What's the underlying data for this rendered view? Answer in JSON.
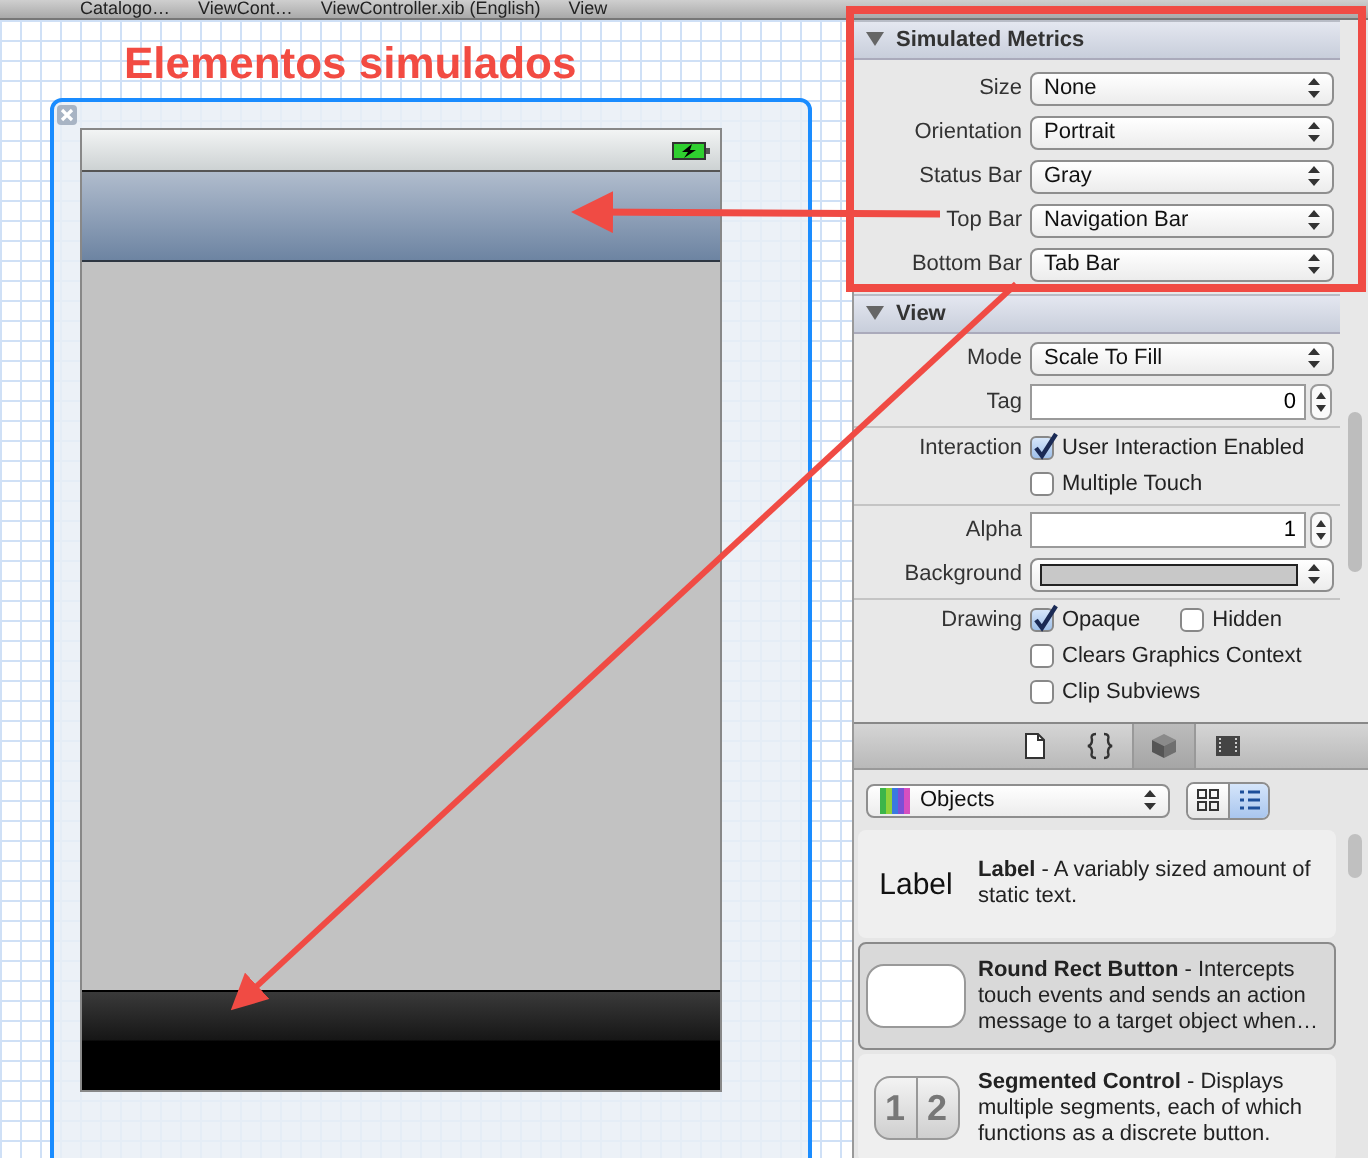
{
  "breadcrumbs": [
    {
      "label": "Catalogo…"
    },
    {
      "label": "ViewCont…"
    },
    {
      "label": "ViewController.xib (English)"
    },
    {
      "label": "View"
    }
  ],
  "annotation": {
    "title": "Elementos simulados"
  },
  "simulated_metrics": {
    "title": "Simulated Metrics",
    "expanded": true,
    "rows": [
      {
        "label": "Size",
        "value": "None"
      },
      {
        "label": "Orientation",
        "value": "Portrait"
      },
      {
        "label": "Status Bar",
        "value": "Gray"
      },
      {
        "label": "Top Bar",
        "value": "Navigation Bar"
      },
      {
        "label": "Bottom Bar",
        "value": "Tab Bar"
      }
    ]
  },
  "view": {
    "title": "View",
    "expanded": true,
    "groups": [
      {
        "rows": [
          {
            "kind": "popup",
            "label": "Mode",
            "value": "Scale To Fill"
          },
          {
            "kind": "stepper",
            "label": "Tag",
            "value": "0"
          }
        ]
      },
      {
        "rows": [
          {
            "kind": "checks",
            "label": "Interaction",
            "options": [
              {
                "label": "User Interaction Enabled",
                "checked": true
              }
            ]
          },
          {
            "kind": "checks",
            "options": [
              {
                "label": "Multiple Touch",
                "checked": false
              }
            ]
          }
        ]
      },
      {
        "rows": [
          {
            "kind": "stepper",
            "label": "Alpha",
            "value": "1"
          },
          {
            "kind": "color",
            "label": "Background",
            "color": "#c8c8c8"
          }
        ]
      },
      {
        "rows": [
          {
            "kind": "checks",
            "label": "Drawing",
            "options": [
              {
                "label": "Opaque",
                "checked": true
              },
              {
                "label": "Hidden",
                "checked": false
              }
            ]
          },
          {
            "kind": "checks",
            "options": [
              {
                "label": "Clears Graphics Context",
                "checked": false
              }
            ]
          },
          {
            "kind": "checks",
            "options": [
              {
                "label": "Clip Subviews",
                "checked": false
              }
            ]
          }
        ]
      }
    ]
  },
  "library": {
    "tabs": [
      {
        "kind": "file",
        "selected": false
      },
      {
        "kind": "braces",
        "selected": false
      },
      {
        "kind": "cube",
        "selected": true
      },
      {
        "kind": "film",
        "selected": false
      }
    ],
    "filter": {
      "value": "Objects"
    },
    "view_modes": [
      {
        "kind": "grid",
        "selected": false
      },
      {
        "kind": "list",
        "selected": true
      }
    ],
    "items": [
      {
        "kind": "label",
        "preview": "Label",
        "text": "**Label** - A variably sized amount of static text.",
        "selected": false
      },
      {
        "kind": "button",
        "text": "**Round Rect Button** - Intercepts touch events and sends an action message to a target object when…",
        "selected": true
      },
      {
        "kind": "segmented",
        "segments": [
          "1",
          "2"
        ],
        "text": "**Segmented Control** - Displays multiple segments, each of which functions as a discrete button.",
        "selected": false
      }
    ]
  }
}
